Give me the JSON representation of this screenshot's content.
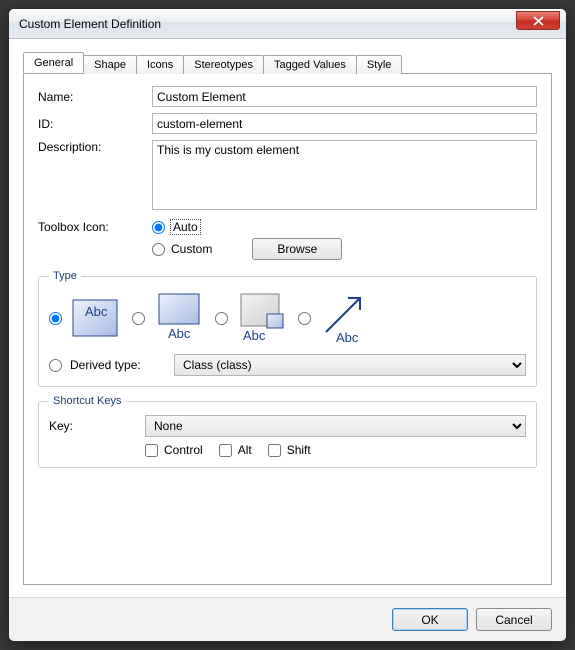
{
  "window": {
    "title": "Custom Element Definition"
  },
  "tabs": [
    "General",
    "Shape",
    "Icons",
    "Stereotypes",
    "Tagged Values",
    "Style"
  ],
  "labels": {
    "name": "Name:",
    "id": "ID:",
    "description": "Description:",
    "toolbox": "Toolbox Icon:",
    "auto": "Auto",
    "custom": "Custom",
    "browse": "Browse",
    "type_legend": "Type",
    "abc": "Abc",
    "derived": "Derived type:",
    "shortcut_legend": "Shortcut Keys",
    "key": "Key:",
    "control": "Control",
    "alt": "Alt",
    "shift": "Shift"
  },
  "fields": {
    "name": "Custom Element",
    "id": "custom-element",
    "description": "This is my custom element",
    "toolbox_mode": "auto",
    "type_selected": 0,
    "derived_type": "Class (class)",
    "key": "None"
  },
  "buttons": {
    "ok": "OK",
    "cancel": "Cancel"
  }
}
